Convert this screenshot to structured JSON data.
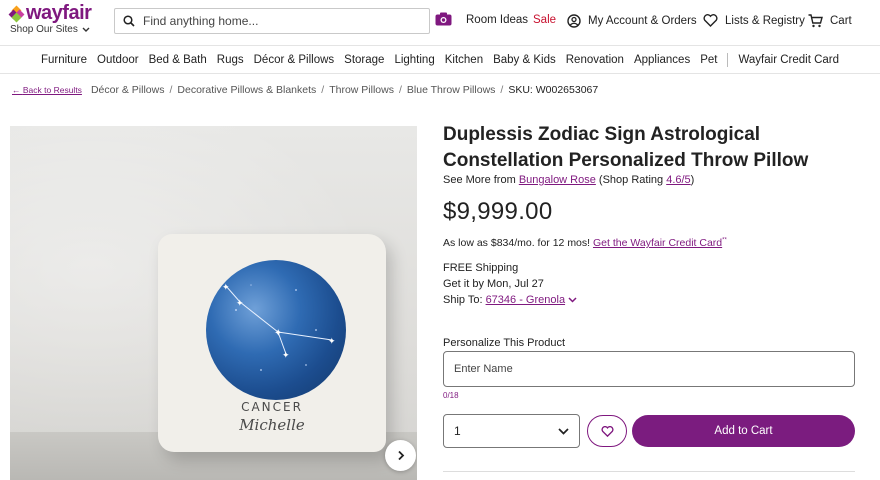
{
  "header": {
    "logo_text": "wayfair",
    "shop_sites": "Shop Our Sites",
    "search_placeholder": "Find anything home...",
    "room_ideas": "Room Ideas",
    "sale": "Sale",
    "account": "My Account & Orders",
    "lists": "Lists & Registry",
    "cart": "Cart"
  },
  "nav": {
    "items": [
      "Furniture",
      "Outdoor",
      "Bed & Bath",
      "Rugs",
      "Décor & Pillows",
      "Storage",
      "Lighting",
      "Kitchen",
      "Baby & Kids",
      "Renovation",
      "Appliances",
      "Pet"
    ],
    "credit_card": "Wayfair Credit Card"
  },
  "breadcrumb": {
    "back": "Back to Results",
    "back_arrow": "←",
    "crumbs": [
      "Décor & Pillows",
      "Decorative Pillows & Blankets",
      "Throw Pillows",
      "Blue Throw Pillows"
    ],
    "separator": "/",
    "sku": "SKU: W002653067"
  },
  "product_image": {
    "sign_name": "CANCER",
    "person_name": "Michelle"
  },
  "product": {
    "title": "Duplessis Zodiac Sign Astrological Constellation Personalized Throw Pillow",
    "see_more_prefix": "See More from ",
    "brand": "Bungalow Rose",
    "rating_prefix": " (Shop Rating ",
    "rating": "4.6/5",
    "rating_suffix": ")",
    "price": "$9,999.00",
    "finance_text": "As low as $834/mo. for 12 mos! ",
    "finance_link": "Get the Wayfair Credit Card",
    "finance_mark": "**",
    "shipping": "FREE Shipping",
    "delivery": "Get it by Mon, Jul 27",
    "ship_to_label": "Ship To: ",
    "ship_to_value": "67346 - Grenola"
  },
  "personalize": {
    "label": "Personalize This Product",
    "placeholder": "Enter Name",
    "counter": "0/18"
  },
  "purchase": {
    "quantity": "1",
    "add_to_cart": "Add to Cart"
  },
  "colors": {
    "brand_purple": "#7f187f",
    "sale_red": "#c8102e"
  }
}
